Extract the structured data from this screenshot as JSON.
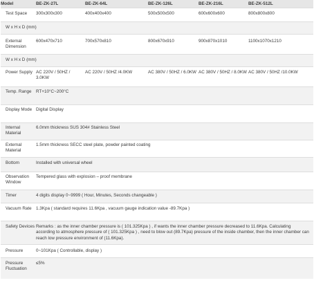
{
  "header": {
    "label": "Model",
    "models": [
      "BE-ZK-27L",
      "BE-ZK-64L",
      "BE-ZK-126L",
      "BE-ZK-216L",
      "BE-ZK-512L"
    ]
  },
  "test_space": {
    "label": "Test Space",
    "values": [
      "300x300x300",
      "400x400x400",
      "500x500x500",
      "600x600x600",
      "800x800x800"
    ]
  },
  "unit_note_1": "W x H x D (mm)",
  "external_dimension": {
    "label": "External Dimension",
    "values": [
      "600x470x710",
      "700x570x810",
      "800x670x910",
      "900x870x1010",
      "1100x1070x1210"
    ]
  },
  "unit_note_2": "W x H x D (mm)",
  "power_supply": {
    "label": "Power Supply",
    "values": [
      "AC 220V / 50HZ / 3.0KW",
      "AC 220V / 50HZ /4.0KW",
      "AC 380V / 50HZ / 6.0KW",
      "AC 380V / 50HZ / 8.0KW",
      "AC 380V / 50HZ /10.0KW"
    ]
  },
  "specs": [
    {
      "label": "Temp. Range",
      "value": "RT+10°C~200°C"
    },
    {
      "label": "Display Mode",
      "value": "Digital Display"
    },
    {
      "label": "Internal Material",
      "value": "6.0mm thickness SUS 304# Stainless Steel"
    },
    {
      "label": "External Material",
      "value": "1.5mm thickness SECC steel plate, powder painted coating"
    },
    {
      "label": "Bottom",
      "value": "Installed with universal wheel"
    },
    {
      "label": "Observation Window",
      "value": "Tempered glass with explosion – proof membrane"
    },
    {
      "label": "Timer",
      "value": "4 digits display 0~9999 ( Hour, Minutes, Seconds changeable )"
    },
    {
      "label": "Vacuum Rate",
      "value": "1.3Kpa ( standard requires 11.6Kpa , vacuum gauge indication value -89.7Kpa )"
    },
    {
      "label": "Safety Devices",
      "value": "Remarks : as the inner chamber pressure is ( 101.325Kpa ) , if wants the inner chamber pressure decreased to 11.6Kpa. Calculating according to atmosphere pressure of ( 101.325Kpa ) , need to blow out (89.7Kpa) pressure of the inside chamber, then the inner chamber can reach low pressure environment of (11.6Kpa)."
    },
    {
      "label": "Pressure",
      "value": "0~101Kpa ( Controllable, display )"
    },
    {
      "label": "Pressure Fluctuation",
      "value": "≤5%"
    }
  ]
}
